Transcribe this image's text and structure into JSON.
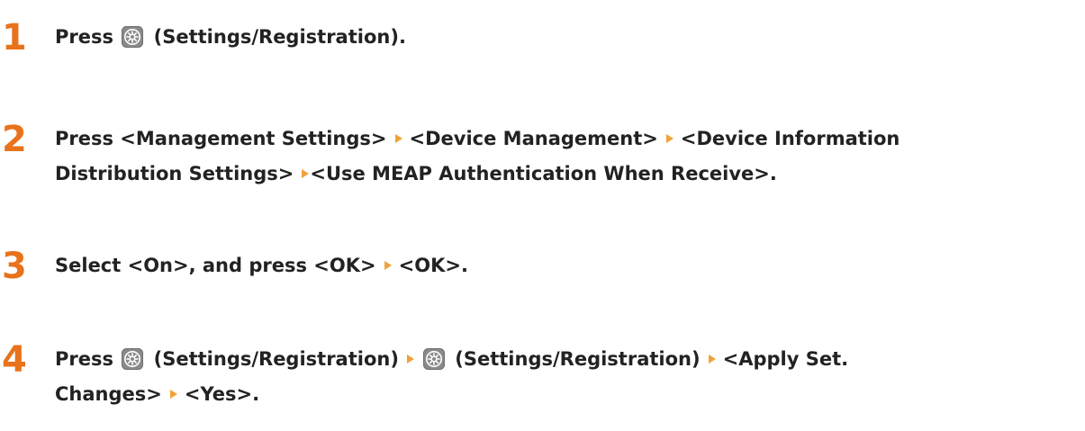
{
  "steps": [
    {
      "number": "1",
      "text": {
        "a": "Press",
        "b": "(Settings/Registration)."
      }
    },
    {
      "number": "2",
      "text": {
        "a": "Press <Management Settings>",
        "b": "<Device Management>",
        "c": "<Device Information",
        "d": "Distribution Settings>",
        "e": "<Use MEAP Authentication When Receive>."
      }
    },
    {
      "number": "3",
      "text": {
        "a": "Select <On>, and press <OK>",
        "b": "<OK>."
      }
    },
    {
      "number": "4",
      "text": {
        "a": "Press",
        "b": "(Settings/Registration)",
        "c": "(Settings/Registration)",
        "d": "<Apply Set.",
        "e": "Changes>",
        "f": "<Yes>."
      }
    }
  ],
  "icons": {
    "settings": "settings-registration-icon",
    "arrow": "arrow-right-icon"
  },
  "colors": {
    "step_number": "#e8731c",
    "arrow": "#f0a33a",
    "text": "#222222"
  }
}
